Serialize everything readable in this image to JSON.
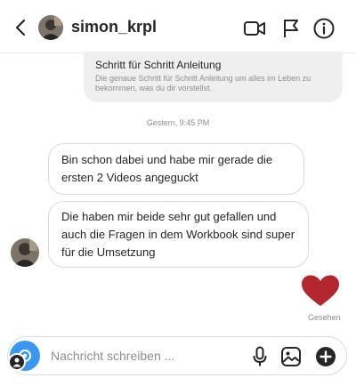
{
  "header": {
    "username": "simon_krpl",
    "icons": [
      "back-arrow-icon",
      "video-camera-icon",
      "flag-icon",
      "info-icon"
    ]
  },
  "link_preview": {
    "title": "Schritt für Schritt Anleitung",
    "description": "Die genaue Schritt für Schritt Anleitung um alles im Leben zu bekommen, was du dir vorstellst."
  },
  "timestamp": "Gestern, 9:45 PM",
  "messages": [
    {
      "text": "Bin schon dabei und habe mir gerade die ersten 2 Videos angeguckt"
    },
    {
      "text": "Die haben mir beide sehr gut gefallen und auch die Fragen in dem Workbook sind super für die Umsetzung"
    }
  ],
  "reaction": {
    "icon": "heart-icon",
    "color": "#b3262e"
  },
  "seen_label": "Gesehen",
  "composer": {
    "placeholder": "Nachricht schreiben ...",
    "icons": [
      "camera-icon",
      "microphone-icon",
      "gallery-icon",
      "add-icon"
    ]
  },
  "colors": {
    "accent": "#3897f0",
    "heart": "#b3262e"
  }
}
